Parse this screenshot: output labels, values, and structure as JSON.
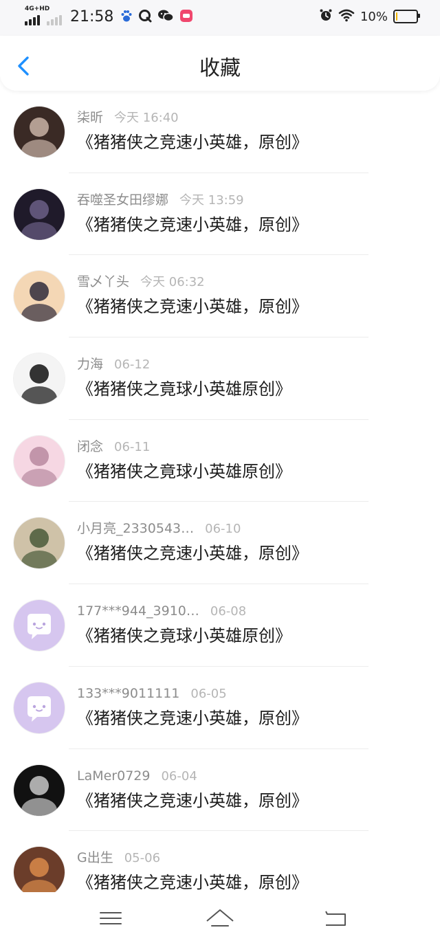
{
  "status_bar": {
    "network": "4G+HD",
    "time": "21:58",
    "battery_percent": "10%",
    "battery_level": 0.1,
    "battery_color": "#f2b600",
    "icons": [
      "baidu-icon",
      "q-browser-icon",
      "wechat-icon",
      "app-badge-icon",
      "alarm-icon",
      "wifi-icon"
    ]
  },
  "header": {
    "title": "收藏",
    "back_icon": "chevron-left-icon",
    "accent_color": "#1e90ff"
  },
  "favorites": [
    {
      "user": "柒昕",
      "when": "今天 16:40",
      "title": "《猪猪侠之竞速小英雄，原创》",
      "avatar": "photo"
    },
    {
      "user": "吞噬圣女田缪娜",
      "when": "今天 13:59",
      "title": "《猪猪侠之竞速小英雄，原创》",
      "avatar": "photo"
    },
    {
      "user": "雪乄丫头",
      "when": "今天 06:32",
      "title": "《猪猪侠之竞速小英雄，原创》",
      "avatar": "photo"
    },
    {
      "user": "力海",
      "when": "06-12",
      "title": "《猪猪侠之竟球小英雄原创》",
      "avatar": "photo"
    },
    {
      "user": "闭念",
      "when": "06-11",
      "title": "《猪猪侠之竟球小英雄原创》",
      "avatar": "photo"
    },
    {
      "user": "小月亮_2330543…",
      "when": "06-10",
      "title": "《猪猪侠之竞速小英雄，原创》",
      "avatar": "photo"
    },
    {
      "user": "177***944_3910…",
      "when": "06-08",
      "title": "《猪猪侠之竟球小英雄原创》",
      "avatar": "default"
    },
    {
      "user": "133***9011111",
      "when": "06-05",
      "title": "《猪猪侠之竞速小英雄，原创》",
      "avatar": "default"
    },
    {
      "user": "LaMer0729",
      "when": "06-04",
      "title": "《猪猪侠之竞速小英雄，原创》",
      "avatar": "photo"
    },
    {
      "user": "G出生",
      "when": "05-06",
      "title": "《猪猪侠之竞速小英雄，原创》",
      "avatar": "photo"
    }
  ],
  "nav_bar": {
    "icons": [
      "menu-icon",
      "home-icon",
      "back-nav-icon"
    ]
  }
}
